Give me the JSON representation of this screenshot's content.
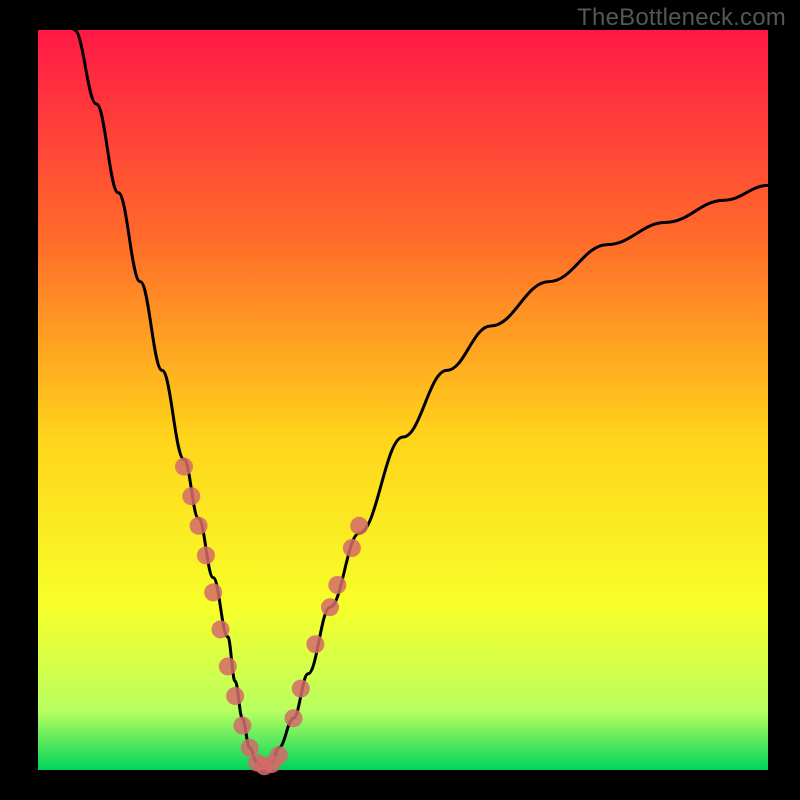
{
  "watermark": "TheBottleneck.com",
  "chart_data": {
    "type": "line",
    "title": "",
    "xlabel": "",
    "ylabel": "",
    "xlim": [
      0,
      100
    ],
    "ylim": [
      0,
      100
    ],
    "legend": false,
    "grid": false,
    "background_gradient": {
      "top": "#ff1846",
      "mid_upper": "#ff6a2a",
      "mid": "#ffd41a",
      "mid_lower": "#f7ff2a",
      "lower": "#b8ff60",
      "bottom": "#00d45a"
    },
    "series": [
      {
        "name": "bottleneck-curve",
        "color": "#000000",
        "x": [
          5,
          8,
          11,
          14,
          17,
          20,
          22,
          24,
          26,
          27,
          28,
          29,
          30,
          31,
          32,
          33,
          35,
          37,
          40,
          44,
          50,
          56,
          62,
          70,
          78,
          86,
          94,
          100
        ],
        "y": [
          100,
          90,
          78,
          66,
          54,
          42,
          34,
          26,
          18,
          12,
          7,
          3,
          1,
          0.5,
          1,
          3,
          7,
          13,
          22,
          32,
          45,
          54,
          60,
          66,
          71,
          74,
          77,
          79
        ]
      }
    ],
    "scatter": [
      {
        "name": "sample-points-left",
        "color": "#d46a6a",
        "points": [
          {
            "x": 20,
            "y": 41
          },
          {
            "x": 21,
            "y": 37
          },
          {
            "x": 22,
            "y": 33
          },
          {
            "x": 23,
            "y": 29
          },
          {
            "x": 24,
            "y": 24
          },
          {
            "x": 25,
            "y": 19
          },
          {
            "x": 26,
            "y": 14
          },
          {
            "x": 27,
            "y": 10
          },
          {
            "x": 28,
            "y": 6
          },
          {
            "x": 29,
            "y": 3
          }
        ]
      },
      {
        "name": "sample-points-bottom",
        "color": "#d46a6a",
        "points": [
          {
            "x": 30,
            "y": 1
          },
          {
            "x": 31,
            "y": 0.5
          },
          {
            "x": 32,
            "y": 0.8
          },
          {
            "x": 33,
            "y": 2
          }
        ]
      },
      {
        "name": "sample-points-right",
        "color": "#d46a6a",
        "points": [
          {
            "x": 35,
            "y": 7
          },
          {
            "x": 36,
            "y": 11
          },
          {
            "x": 38,
            "y": 17
          },
          {
            "x": 40,
            "y": 22
          },
          {
            "x": 41,
            "y": 25
          },
          {
            "x": 43,
            "y": 30
          },
          {
            "x": 44,
            "y": 33
          }
        ]
      }
    ]
  }
}
